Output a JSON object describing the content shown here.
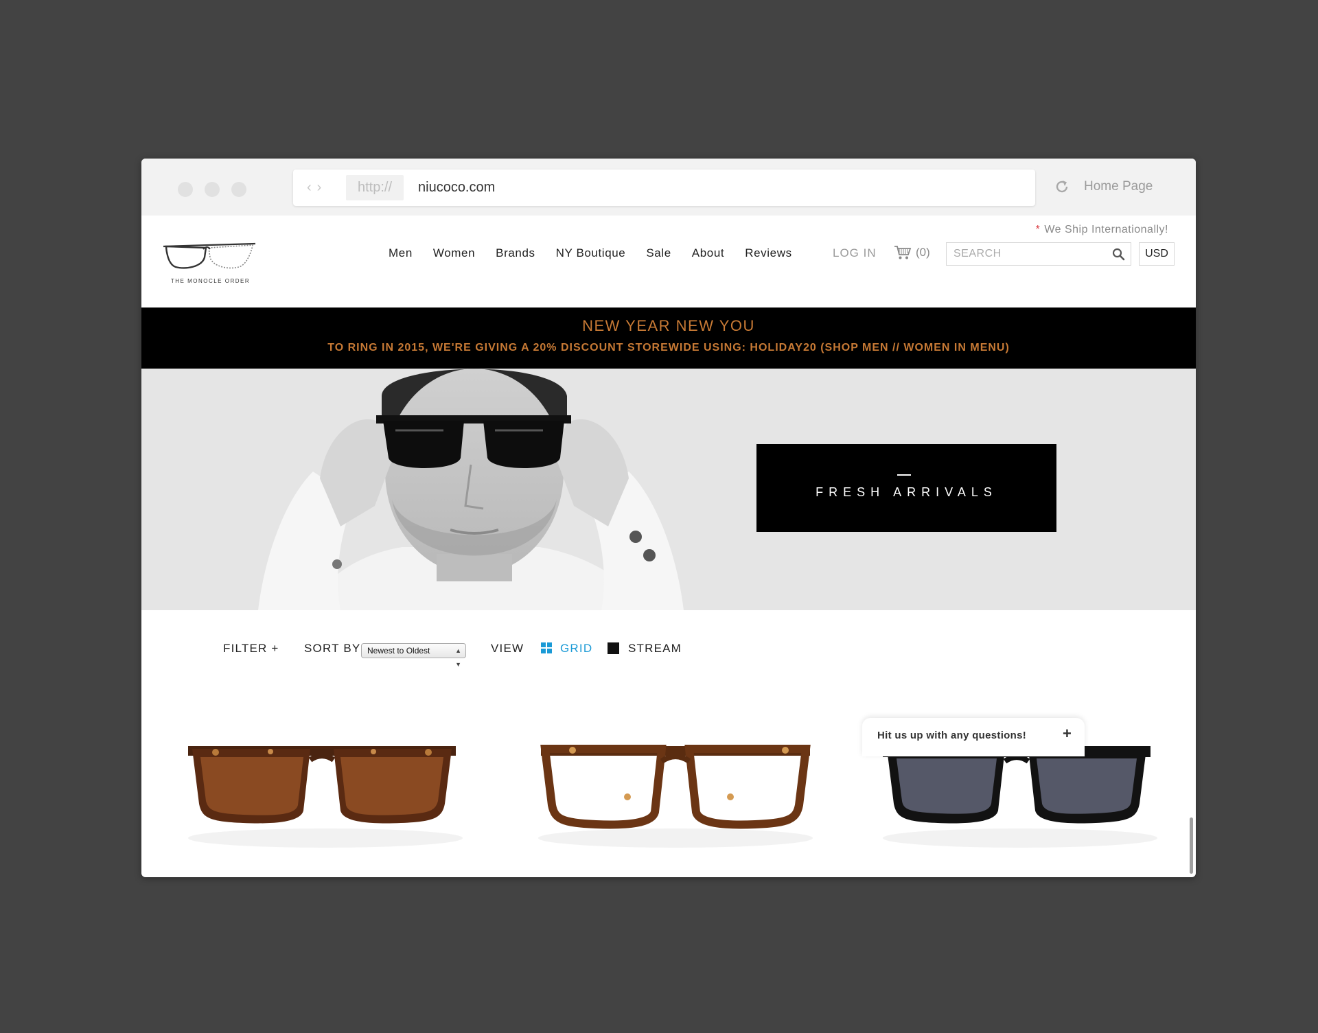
{
  "browser": {
    "protocol": "http://",
    "url": "niucoco.com",
    "home_label": "Home Page"
  },
  "header": {
    "ship_note_star": "*",
    "ship_note": "We Ship Internationally!",
    "nav": [
      "Men",
      "Women",
      "Brands",
      "NY Boutique",
      "Sale",
      "About",
      "Reviews"
    ],
    "login_label": "LOG IN",
    "cart_count": "(0)",
    "search_placeholder": "SEARCH",
    "currency": "USD",
    "logo_text": "THE MONOCLE ORDER"
  },
  "promo": {
    "title": "NEW YEAR NEW YOU",
    "subtitle": "TO RING IN 2015, WE'RE GIVING A 20% DISCOUNT STOREWIDE USING: HOLIDAY20 (SHOP MEN // WOMEN IN MENU)",
    "color": "#c87a35"
  },
  "hero": {
    "cta_label": "FRESH ARRIVALS"
  },
  "toolbar": {
    "filter_label": "FILTER +",
    "sort_label": "SORT BY",
    "sort_value": "Newest to Oldest",
    "view_label": "VIEW",
    "grid_label": "GRID",
    "stream_label": "STREAM",
    "active_view_color": "#1a9ad6"
  },
  "products": [
    {
      "style": "tortoise-sunglasses-brown-lens"
    },
    {
      "style": "tortoise-optical-clear-lens"
    },
    {
      "style": "black-sunglasses-grey-lens"
    }
  ],
  "chat": {
    "label": "Hit us up with any questions!",
    "icon": "plus-icon"
  }
}
